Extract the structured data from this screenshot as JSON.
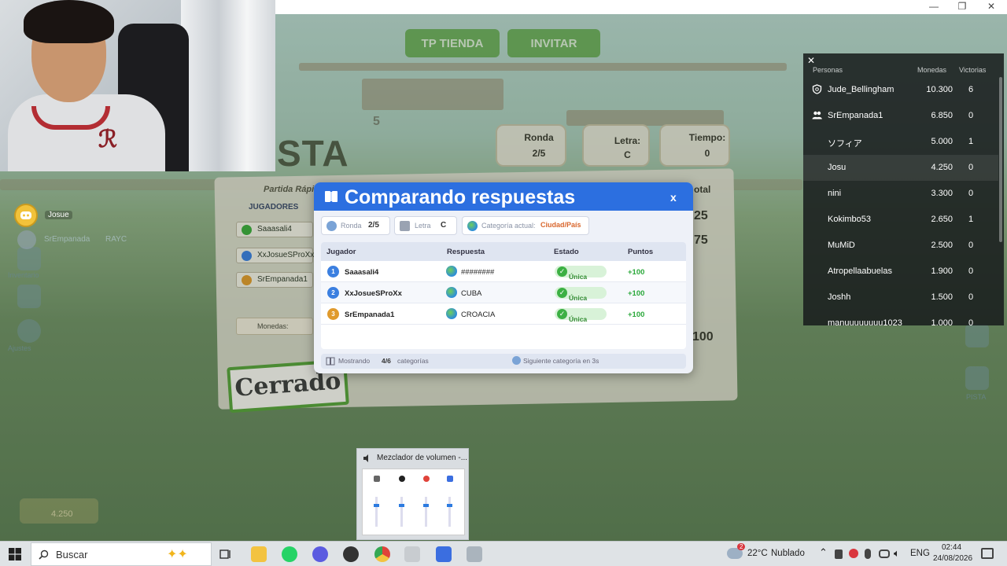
{
  "window": {
    "minimize": "—",
    "maximize": "❐",
    "close": "✕"
  },
  "game": {
    "top_buttons": {
      "tp_tienda": "TP TIENDA",
      "invitar": "INVITAR"
    },
    "board_title": "STA",
    "board_subtitle": "Partida Rápi",
    "board_number": "5",
    "players_label": "JUGADORES",
    "side_players": [
      "Saaasali4",
      "XxJosueSProXx",
      "SrEmpanada1"
    ],
    "monedas_label": "Monedas:",
    "cerrado": "Cerrado",
    "hud_ronda_label": "Ronda",
    "hud_ronda_value": "2/5",
    "hud_letra_label": "Letra:",
    "hud_letra_value": "C",
    "hud_tiempo_label": "Tiempo:",
    "hud_tiempo_value": "0",
    "board_partial_total": "otal",
    "board_nums": [
      "25",
      "75",
      "100"
    ],
    "bottom_coins": "4.250",
    "left_user": "Josue",
    "left_user2": "SrEmpanada",
    "left_tag": "RAYC",
    "inventario": "Inventario",
    "ajustes": "Ajustes",
    "pista": "PISTA"
  },
  "leaderboard": {
    "headers": {
      "personas": "Personas",
      "monedas": "Monedas",
      "victorias": "Victorias"
    },
    "rows": [
      {
        "name": "Jude_Bellingham",
        "coins": "10.300",
        "wins": "6"
      },
      {
        "name": "SrEmpanada1",
        "coins": "6.850",
        "wins": "0"
      },
      {
        "name": "ソフィア",
        "coins": "5.000",
        "wins": "1"
      },
      {
        "name": "Josu",
        "coins": "4.250",
        "wins": "0"
      },
      {
        "name": "nini",
        "coins": "3.300",
        "wins": "0"
      },
      {
        "name": "Kokimbo53",
        "coins": "2.650",
        "wins": "1"
      },
      {
        "name": "MuMiD",
        "coins": "2.500",
        "wins": "0"
      },
      {
        "name": "Atropellaabuelas",
        "coins": "1.900",
        "wins": "0"
      },
      {
        "name": "Joshh",
        "coins": "1.500",
        "wins": "0"
      },
      {
        "name": "manuuuuuuuu1023",
        "coins": "1.000",
        "wins": "0"
      }
    ]
  },
  "modal": {
    "title": "Comparando respuestas",
    "close": "x",
    "chips": {
      "ronda_label": "Ronda",
      "ronda_value": "2/5",
      "letra_label": "Letra",
      "letra_value": "C",
      "categoria_label": "Categoría actual:",
      "categoria_value": "Ciudad/País"
    },
    "columns": {
      "jugador": "Jugador",
      "respuesta": "Respuesta",
      "estado": "Estado",
      "puntos": "Puntos"
    },
    "rows": [
      {
        "rank": "1",
        "player": "Saaasali4",
        "answer": "########",
        "status": "Única",
        "points": "+100",
        "color": "#3b7fe0"
      },
      {
        "rank": "2",
        "player": "XxJosueSProXx",
        "answer": "CUBA",
        "status": "Única",
        "points": "+100",
        "color": "#3b7fe0"
      },
      {
        "rank": "3",
        "player": "SrEmpanada1",
        "answer": "CROACIA",
        "status": "Única",
        "points": "+100",
        "color": "#e09a2c"
      }
    ],
    "footer": {
      "mostrando": "Mostrando",
      "count": "4/6",
      "categorias": "categorías",
      "siguiente": "Siguiente categoría en 3s"
    }
  },
  "taskbar": {
    "search_placeholder": "Buscar",
    "volume_mixer_title": "Mezclador de volumen -...",
    "weather_temp": "22°C",
    "weather_text": "Nublado",
    "weather_badge": "2",
    "language": "ENG",
    "time": "02:44",
    "date": "24/08/2026",
    "colors": {
      "whatsapp": "#25d366",
      "chrome": "#e0433a",
      "explorer": "#f3c340",
      "roblox": "#3b6ee0"
    }
  }
}
